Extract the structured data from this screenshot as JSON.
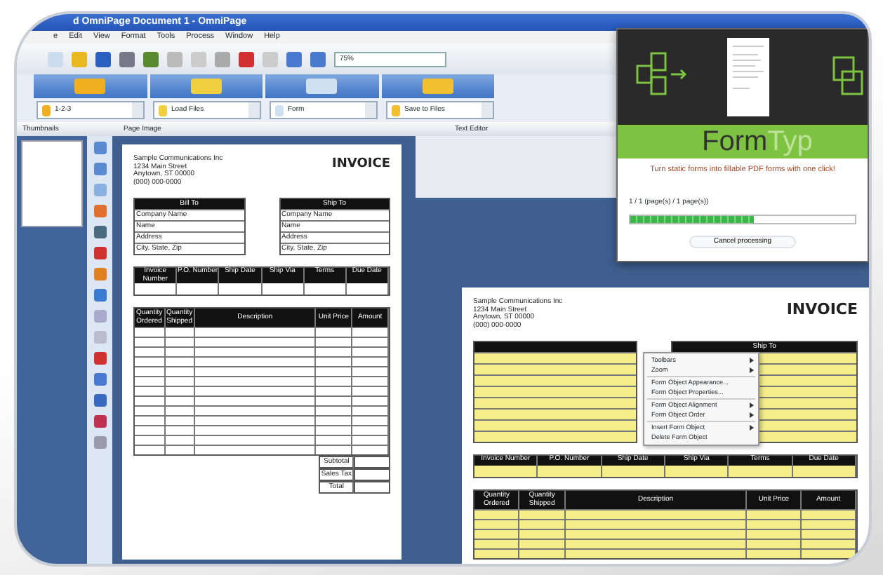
{
  "window": {
    "title": "d OmniPage Document 1 - OmniPage"
  },
  "menu": [
    "e",
    "Edit",
    "View",
    "Format",
    "Tools",
    "Process",
    "Window",
    "Help"
  ],
  "toolbar": {
    "zoom": "75%"
  },
  "workflow": [
    {
      "label": "1-2-3"
    },
    {
      "label": "Load Files"
    },
    {
      "label": "Form"
    },
    {
      "label": "Save to Files"
    }
  ],
  "panes": {
    "thumbnails": "Thumbnails",
    "page_image": "Page Image",
    "text_editor": "Text Editor"
  },
  "invoices": [
    {
      "kind": "scan",
      "company": [
        "Sample Communications Inc",
        "1234 Main Street",
        "Anytown, ST 00000",
        "(000) 000-0000"
      ],
      "heading": "INVOICE",
      "bill_to": {
        "title": "Bill To",
        "fields": [
          "Company Name",
          "Name",
          "Address",
          "City, State, Zip"
        ]
      },
      "ship_to": {
        "title": "Ship To",
        "fields": [
          "Company Name",
          "Name",
          "Address",
          "City, State, Zip"
        ]
      },
      "order_columns": [
        "Invoice Number",
        "P.O. Number",
        "Ship Date",
        "Ship Via",
        "Terms",
        "Due Date"
      ],
      "item_columns": [
        "Quantity Ordered",
        "Quantity Shipped",
        "Description",
        "Unit Price",
        "Amount"
      ],
      "totals": [
        "Subtotal",
        "Sales Tax",
        "Total"
      ]
    },
    {
      "kind": "form",
      "company": [
        "Sample Communications Inc",
        "1234 Main Street",
        "Anytown, ST 00000",
        "(000) 000-0000"
      ],
      "heading": "INVOICE",
      "ship_to": {
        "title": "Ship To"
      },
      "order_columns": [
        "Invoice Number",
        "P.O. Number",
        "Ship Date",
        "Ship Via",
        "Terms",
        "Due Date"
      ],
      "item_columns": [
        "Quantity Ordered",
        "Quantity Shipped",
        "Description",
        "Unit Price",
        "Amount"
      ]
    }
  ],
  "context_menu": [
    {
      "label": "Toolbars",
      "submenu": true
    },
    {
      "label": "Zoom",
      "submenu": true
    },
    {
      "label": "Form Object Appearance...",
      "submenu": false
    },
    {
      "label": "Form Object Properties...",
      "submenu": false
    },
    {
      "label": "Form Object Alignment",
      "submenu": true
    },
    {
      "label": "Form Object Order",
      "submenu": true
    },
    {
      "label": "Insert Form Object",
      "submenu": true
    },
    {
      "label": "Delete Form Object",
      "submenu": false
    }
  ],
  "formtyper": {
    "brand": "Form",
    "brand_cut": "Typ",
    "tagline": "Turn static forms into fillable PDF forms with one click!",
    "status": "1 / 1 (page(s) / 1 page(s))",
    "level": 0.55,
    "button": "Cancel processing"
  }
}
